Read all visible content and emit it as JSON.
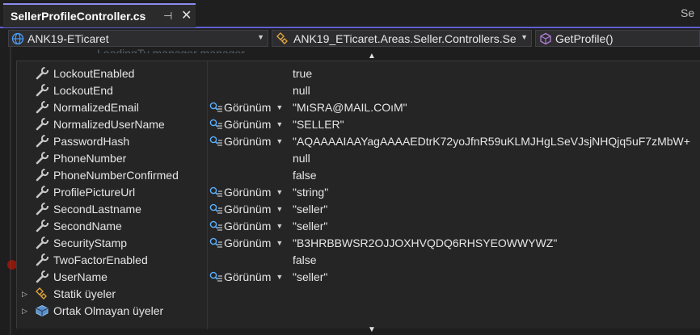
{
  "tab": {
    "title": "SellerProfileController.cs",
    "pin_glyph": "⊣",
    "close_glyph": "✕",
    "overflow_label": "Se"
  },
  "navbar": {
    "project": "ANK19-ETicaret",
    "type": "ANK19_ETicaret.Areas.Seller.Controllers.Se",
    "member": "GetProfile()"
  },
  "code_peek": "LeadingTy  manager  manager",
  "datatip": {
    "visualizer_label": "Görünüm",
    "rows": [
      {
        "name": "LockoutEnabled",
        "value": "true",
        "viz": false
      },
      {
        "name": "LockoutEnd",
        "value": "null",
        "viz": false
      },
      {
        "name": "NormalizedEmail",
        "value": "\"MıSRA@MAIL.COıM\"",
        "viz": true
      },
      {
        "name": "NormalizedUserName",
        "value": "\"SELLER\"",
        "viz": true
      },
      {
        "name": "PasswordHash",
        "value": "\"AQAAAAIAAYagAAAAEDtrK72yoJfnR59uKLMJHgLSeVJsjNHQjq5uF7zMbW+",
        "viz": true
      },
      {
        "name": "PhoneNumber",
        "value": "null",
        "viz": false
      },
      {
        "name": "PhoneNumberConfirmed",
        "value": "false",
        "viz": false
      },
      {
        "name": "ProfilePictureUrl",
        "value": "\"string\"",
        "viz": true
      },
      {
        "name": "SecondLastname",
        "value": "\"seller\"",
        "viz": true
      },
      {
        "name": "SecondName",
        "value": "\"seller\"",
        "viz": true
      },
      {
        "name": "SecurityStamp",
        "value": "\"B3HRBBWSR2OJJOXHVQDQ6RHSYEOWWYWZ\"",
        "viz": true
      },
      {
        "name": "TwoFactorEnabled",
        "value": "false",
        "viz": false
      },
      {
        "name": "UserName",
        "value": "\"seller\"",
        "viz": true
      }
    ],
    "groups": [
      {
        "name": "Statik üyeler",
        "icon": "static-members-icon"
      },
      {
        "name": "Ortak Olmayan üyeler",
        "icon": "non-public-members-icon"
      }
    ]
  },
  "colors": {
    "accent": "#5d5fd0",
    "background": "#1e1e1e",
    "datatip_bg": "#252526",
    "text": "#e6e6e6"
  }
}
